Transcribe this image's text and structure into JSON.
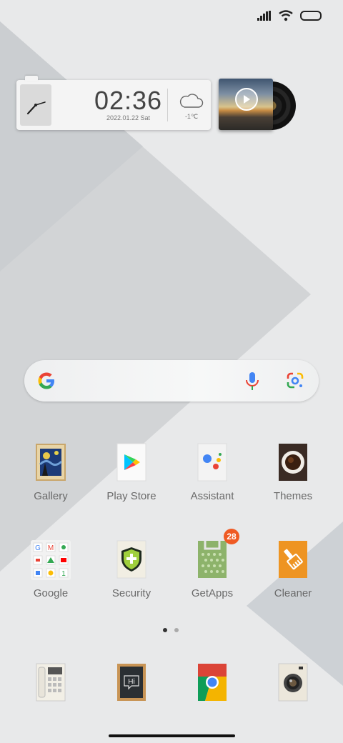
{
  "widgets": {
    "clock": {
      "time": "02:36",
      "date": "2022.01.22 Sat"
    },
    "weather": {
      "temperature": "-1℃",
      "icon": "cloud-icon"
    },
    "music": {
      "icon": "play-icon"
    }
  },
  "search": {
    "icons": [
      "google-g-icon",
      "microphone-icon",
      "google-lens-icon"
    ]
  },
  "apps_row1": [
    {
      "label": "Gallery",
      "icon": "gallery-icon"
    },
    {
      "label": "Play Store",
      "icon": "play-store-icon"
    },
    {
      "label": "Assistant",
      "icon": "assistant-icon"
    },
    {
      "label": "Themes",
      "icon": "themes-icon"
    }
  ],
  "apps_row2": [
    {
      "label": "Google",
      "icon": "google-folder-icon"
    },
    {
      "label": "Security",
      "icon": "security-icon"
    },
    {
      "label": "GetApps",
      "icon": "getapps-icon",
      "badge": "28"
    },
    {
      "label": "Cleaner",
      "icon": "cleaner-icon"
    }
  ],
  "dock": [
    {
      "icon": "phone-icon"
    },
    {
      "icon": "messages-icon",
      "text": "Hi"
    },
    {
      "icon": "chrome-icon"
    },
    {
      "icon": "camera-icon"
    }
  ],
  "pager": {
    "pages": 2,
    "current": 1
  },
  "colors": {
    "badge": "#ef5a23",
    "background": "#e8e9ea"
  }
}
